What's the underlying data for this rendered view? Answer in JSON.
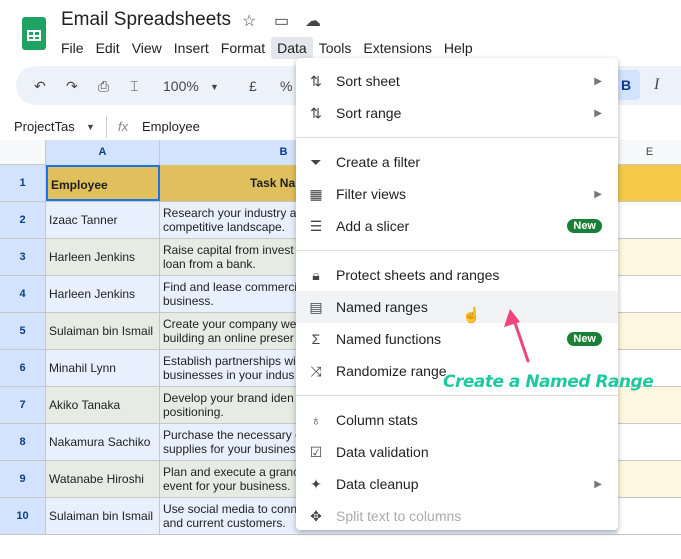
{
  "app": {
    "title": "Email Spreadsheets",
    "menu": [
      "File",
      "Edit",
      "View",
      "Insert",
      "Format",
      "Data",
      "Tools",
      "Extensions",
      "Help"
    ],
    "active_menu": "Data"
  },
  "toolbar": {
    "zoom": "100%",
    "currency": "£",
    "percent": "%",
    "bold": "B",
    "italic": "I"
  },
  "formula_bar": {
    "name_box": "ProjectTas",
    "fx": "fx",
    "value": "Employee"
  },
  "columns": [
    "A",
    "B",
    "E"
  ],
  "rows": [
    {
      "n": "1",
      "a": "Employee",
      "b": "Task Na"
    },
    {
      "n": "2",
      "a": "Izaac Tanner",
      "b": "Research your industry a\ncompetitive landscape."
    },
    {
      "n": "3",
      "a": "Harleen Jenkins",
      "b": "Raise capital from invest\nloan from a bank."
    },
    {
      "n": "4",
      "a": "Harleen Jenkins",
      "b": "Find and lease commerci\nbusiness."
    },
    {
      "n": "5",
      "a": "Sulaiman bin Ismail",
      "b": "Create your company we\nbuilding an online preser"
    },
    {
      "n": "6",
      "a": "Minahil Lynn",
      "b": "Establish partnerships wi\nbusinesses in your indus"
    },
    {
      "n": "7",
      "a": "Akiko Tanaka",
      "b": "Develop your brand iden\npositioning."
    },
    {
      "n": "8",
      "a": "Nakamura Sachiko",
      "b": "Purchase the necessary e\nsupplies for your busines"
    },
    {
      "n": "9",
      "a": "Watanabe Hiroshi",
      "b": "Plan and execute a granc\nevent for your business."
    },
    {
      "n": "10",
      "a": "Sulaiman bin Ismail",
      "b": "Use social media to conn\nand current customers."
    }
  ],
  "menu": {
    "groups": [
      [
        {
          "label": "Sort sheet",
          "icon": "sort-icon",
          "submenu": true
        },
        {
          "label": "Sort range",
          "icon": "sort-icon",
          "submenu": true
        }
      ],
      [
        {
          "label": "Create a filter",
          "icon": "filter-icon"
        },
        {
          "label": "Filter views",
          "icon": "filter-views-icon",
          "submenu": true
        },
        {
          "label": "Add a slicer",
          "icon": "slicer-icon",
          "badge": "New"
        }
      ],
      [
        {
          "label": "Protect sheets and ranges",
          "icon": "lock-icon"
        },
        {
          "label": "Named ranges",
          "icon": "named-ranges-icon",
          "hover": true
        },
        {
          "label": "Named functions",
          "icon": "sigma-icon",
          "badge": "New"
        },
        {
          "label": "Randomize range",
          "icon": "shuffle-icon"
        }
      ],
      [
        {
          "label": "Column stats",
          "icon": "lightbulb-icon"
        },
        {
          "label": "Data validation",
          "icon": "data-validation-icon"
        },
        {
          "label": "Data cleanup",
          "icon": "magic-wand-icon",
          "submenu": true
        },
        {
          "label": "Split text to columns",
          "icon": "split-icon",
          "disabled": true
        }
      ]
    ]
  },
  "annotation": "Create a Named Range",
  "colors": {
    "accent": "#1fc8a0",
    "arrow": "#f0457a",
    "header_row": "#e0c05c",
    "badge": "#188038"
  }
}
